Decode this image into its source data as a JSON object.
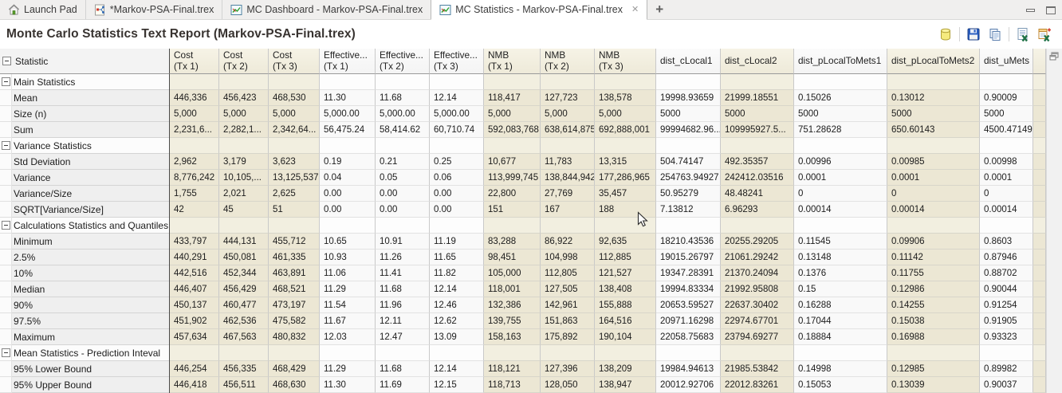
{
  "tabs": [
    {
      "label": "Launch Pad",
      "icon": "home-icon",
      "active": false
    },
    {
      "label": "*Markov-PSA-Final.trex",
      "icon": "tree-icon",
      "active": false
    },
    {
      "label": "MC Dashboard - Markov-PSA-Final.trex",
      "icon": "chart-icon",
      "active": false
    },
    {
      "label": "MC Statistics - Markov-PSA-Final.trex",
      "icon": "chart-icon",
      "active": true,
      "close_glyph": "✕"
    }
  ],
  "new_tab_glyph": "+",
  "report": {
    "title": "Monte Carlo Statistics Text Report (Markov-PSA-Final.trex)"
  },
  "toolbar": {
    "icons": [
      "database-icon",
      "save-icon",
      "copy-icon",
      "export-excel-icon",
      "export-excel-add-icon"
    ]
  },
  "palette": {
    "beige_column": "#ece7d4",
    "white_column": "#f9f9f9",
    "statistic_column": "#efefef",
    "save_blue": "#2b5fc0",
    "excel_green": "#1e7145",
    "database_yellow": "#f5ea7e"
  },
  "table": {
    "corner_label": "Statistic",
    "columns": [
      {
        "id": "cost-tx1",
        "line1": "Cost",
        "line2": "(Tx 1)",
        "tone": "beige"
      },
      {
        "id": "cost-tx2",
        "line1": "Cost",
        "line2": "(Tx 2)",
        "tone": "beige"
      },
      {
        "id": "cost-tx3",
        "line1": "Cost",
        "line2": "(Tx 3)",
        "tone": "beige"
      },
      {
        "id": "effectiveness-tx1",
        "line1": "Effective...",
        "line2": "(Tx 1)",
        "tone": "white"
      },
      {
        "id": "effectiveness-tx2",
        "line1": "Effective...",
        "line2": "(Tx 2)",
        "tone": "white"
      },
      {
        "id": "effectiveness-tx3",
        "line1": "Effective...",
        "line2": "(Tx 3)",
        "tone": "white"
      },
      {
        "id": "nmb-tx1",
        "line1": "NMB",
        "line2": "(Tx 1)",
        "tone": "beige"
      },
      {
        "id": "nmb-tx2",
        "line1": "NMB",
        "line2": "(Tx 2)",
        "tone": "beige"
      },
      {
        "id": "nmb-tx3",
        "line1": "NMB",
        "line2": "(Tx 3)",
        "tone": "beige"
      },
      {
        "id": "dist-clocal1",
        "line1": "dist_cLocal1",
        "line2": "",
        "tone": "white"
      },
      {
        "id": "dist-clocal2",
        "line1": "dist_cLocal2",
        "line2": "",
        "tone": "beige"
      },
      {
        "id": "dist-plocaltomets1",
        "line1": "dist_pLocalToMets1",
        "line2": "",
        "tone": "white"
      },
      {
        "id": "dist-plocaltomets2",
        "line1": "dist_pLocalToMets2",
        "line2": "",
        "tone": "beige"
      },
      {
        "id": "dist-umets",
        "line1": "dist_uMets",
        "line2": "",
        "tone": "white"
      }
    ],
    "rows": [
      {
        "type": "group",
        "label": "Main Statistics"
      },
      {
        "type": "data",
        "label": "Mean",
        "values": [
          "446,336",
          "456,423",
          "468,530",
          "11.30",
          "11.68",
          "12.14",
          "118,417",
          "127,723",
          "138,578",
          "19998.93659",
          "21999.18551",
          "0.15026",
          "0.13012",
          "0.90009"
        ]
      },
      {
        "type": "data",
        "label": "Size (n)",
        "values": [
          "5,000",
          "5,000",
          "5,000",
          "5,000.00",
          "5,000.00",
          "5,000.00",
          "5,000",
          "5,000",
          "5,000",
          "5000",
          "5000",
          "5000",
          "5000",
          "5000"
        ]
      },
      {
        "type": "data",
        "label": "Sum",
        "values": [
          "2,231,6...",
          "2,282,1...",
          "2,342,64...",
          "56,475.24",
          "58,414.62",
          "60,710.74",
          "592,083,768",
          "638,614,875",
          "692,888,001",
          "99994682.96...",
          "109995927.5...",
          "751.28628",
          "650.60143",
          "4500.47149"
        ]
      },
      {
        "type": "group",
        "label": "Variance Statistics"
      },
      {
        "type": "data",
        "label": "Std Deviation",
        "values": [
          "2,962",
          "3,179",
          "3,623",
          "0.19",
          "0.21",
          "0.25",
          "10,677",
          "11,783",
          "13,315",
          "504.74147",
          "492.35357",
          "0.00996",
          "0.00985",
          "0.00998"
        ]
      },
      {
        "type": "data",
        "label": "Variance",
        "values": [
          "8,776,242",
          "10,105,...",
          "13,125,537",
          "0.04",
          "0.05",
          "0.06",
          "113,999,745",
          "138,844,942",
          "177,286,965",
          "254763.94927",
          "242412.03516",
          "0.0001",
          "0.0001",
          "0.0001"
        ]
      },
      {
        "type": "data",
        "label": "Variance/Size",
        "values": [
          "1,755",
          "2,021",
          "2,625",
          "0.00",
          "0.00",
          "0.00",
          "22,800",
          "27,769",
          "35,457",
          "50.95279",
          "48.48241",
          "0",
          "0",
          "0"
        ]
      },
      {
        "type": "data",
        "label": "SQRT[Variance/Size]",
        "values": [
          "42",
          "45",
          "51",
          "0.00",
          "0.00",
          "0.00",
          "151",
          "167",
          "188",
          "7.13812",
          "6.96293",
          "0.00014",
          "0.00014",
          "0.00014"
        ]
      },
      {
        "type": "group",
        "label": "Calculations Statistics and Quantiles"
      },
      {
        "type": "data",
        "label": "Minimum",
        "values": [
          "433,797",
          "444,131",
          "455,712",
          "10.65",
          "10.91",
          "11.19",
          "83,288",
          "86,922",
          "92,635",
          "18210.43536",
          "20255.29205",
          "0.11545",
          "0.09906",
          "0.8603"
        ]
      },
      {
        "type": "data",
        "label": "2.5%",
        "values": [
          "440,291",
          "450,081",
          "461,335",
          "10.93",
          "11.26",
          "11.65",
          "98,451",
          "104,998",
          "112,885",
          "19015.26797",
          "21061.29242",
          "0.13148",
          "0.11142",
          "0.87946"
        ]
      },
      {
        "type": "data",
        "label": "10%",
        "values": [
          "442,516",
          "452,344",
          "463,891",
          "11.06",
          "11.41",
          "11.82",
          "105,000",
          "112,805",
          "121,527",
          "19347.28391",
          "21370.24094",
          "0.1376",
          "0.11755",
          "0.88702"
        ]
      },
      {
        "type": "data",
        "label": "Median",
        "values": [
          "446,407",
          "456,429",
          "468,521",
          "11.29",
          "11.68",
          "12.14",
          "118,001",
          "127,505",
          "138,408",
          "19994.83334",
          "21992.95808",
          "0.15",
          "0.12986",
          "0.90044"
        ]
      },
      {
        "type": "data",
        "label": "90%",
        "values": [
          "450,137",
          "460,477",
          "473,197",
          "11.54",
          "11.96",
          "12.46",
          "132,386",
          "142,961",
          "155,888",
          "20653.59527",
          "22637.30402",
          "0.16288",
          "0.14255",
          "0.91254"
        ]
      },
      {
        "type": "data",
        "label": "97.5%",
        "values": [
          "451,902",
          "462,536",
          "475,582",
          "11.67",
          "12.11",
          "12.62",
          "139,755",
          "151,863",
          "164,516",
          "20971.16298",
          "22974.67701",
          "0.17044",
          "0.15038",
          "0.91905"
        ]
      },
      {
        "type": "data",
        "label": "Maximum",
        "values": [
          "457,634",
          "467,563",
          "480,832",
          "12.03",
          "12.47",
          "13.09",
          "158,163",
          "175,892",
          "190,104",
          "22058.75683",
          "23794.69277",
          "0.18884",
          "0.16988",
          "0.93323"
        ]
      },
      {
        "type": "group",
        "label": "Mean Statistics - Prediction Inteval"
      },
      {
        "type": "data",
        "label": "95% Lower Bound",
        "values": [
          "446,254",
          "456,335",
          "468,429",
          "11.29",
          "11.68",
          "12.14",
          "118,121",
          "127,396",
          "138,209",
          "19984.94613",
          "21985.53842",
          "0.14998",
          "0.12985",
          "0.89982"
        ]
      },
      {
        "type": "data",
        "label": "95% Upper Bound",
        "values": [
          "446,418",
          "456,511",
          "468,630",
          "11.30",
          "11.69",
          "12.15",
          "118,713",
          "128,050",
          "138,947",
          "20012.92706",
          "22012.83261",
          "0.15053",
          "0.13039",
          "0.90037"
        ]
      }
    ]
  }
}
